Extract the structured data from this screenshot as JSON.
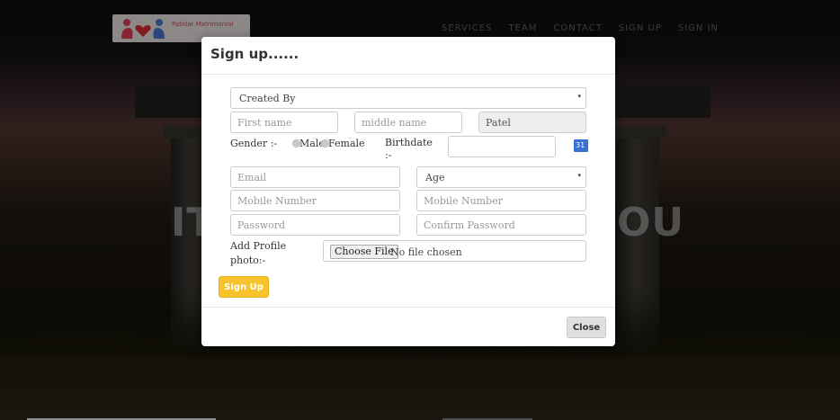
{
  "navbar": {
    "brand": "Patidar Matrimonial",
    "links": [
      "SERVICES",
      "TEAM",
      "CONTACT",
      "SIGN UP",
      "SIGN IN"
    ]
  },
  "hero": {
    "text_left": "IT",
    "text_right": "OU"
  },
  "modal": {
    "title": "Sign up......",
    "created_by": "Created By",
    "first_name_placeholder": "First name",
    "middle_name_placeholder": "middle name",
    "last_name_value": "Patel",
    "gender_label": "Gender :-",
    "gender_male": "Male",
    "gender_female": "Female",
    "birthdate_label_1": "Birthdate",
    "birthdate_label_2": ":-",
    "calendar_icon": "31",
    "email_placeholder": "Email",
    "age_select": "Age",
    "mobile_placeholder_1": "Mobile Number",
    "mobile_placeholder_2": "Mobile Number",
    "password_placeholder": "Password",
    "confirm_password_placeholder": "Confirm Password",
    "photo_label_1": "Add Profile",
    "photo_label_2": "photo:-",
    "choose_file": "Choose File",
    "no_file": "No file chosen",
    "signup_button": "Sign Up",
    "close_button": "Close"
  }
}
